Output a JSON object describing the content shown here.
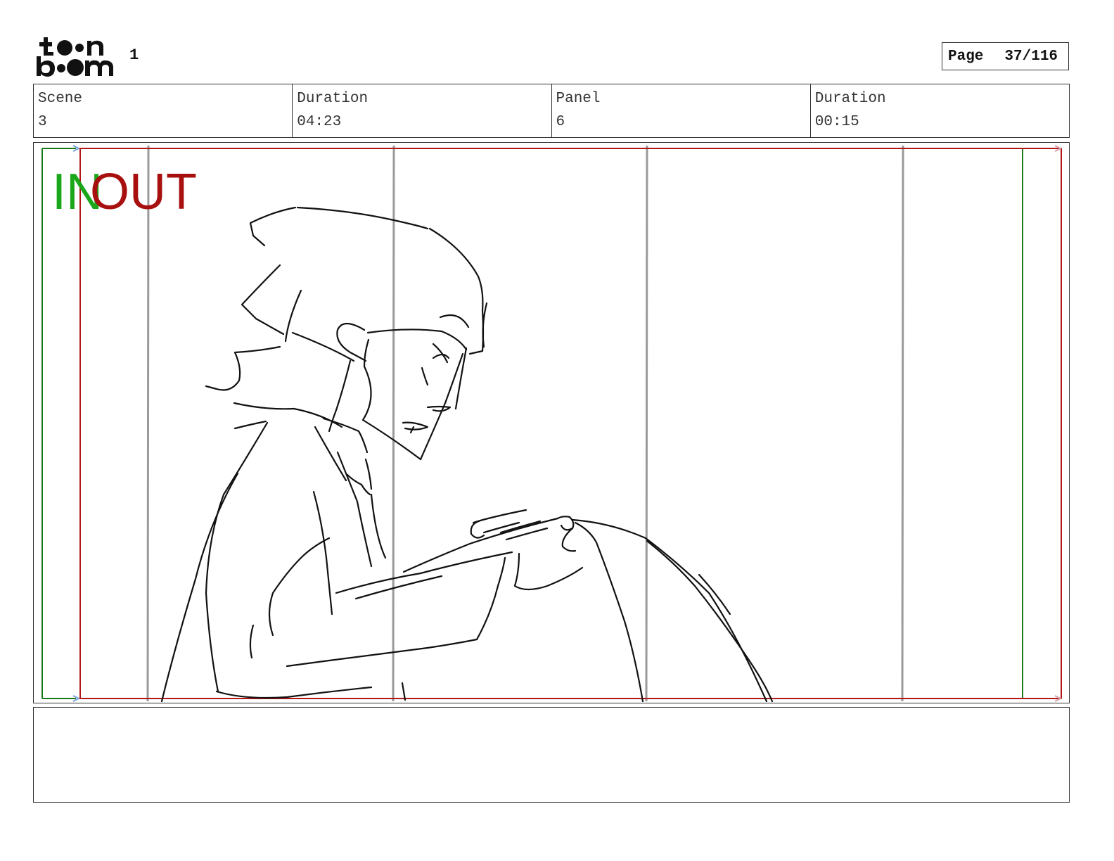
{
  "header": {
    "brand": "toon boom",
    "sequence_number": "1",
    "page_label": "Page",
    "page_value": "37/116"
  },
  "info": {
    "scene_label": "Scene",
    "scene_value": "3",
    "scene_duration_label": "Duration",
    "scene_duration_value": "04:23",
    "panel_label": "Panel",
    "panel_value": "6",
    "panel_duration_label": "Duration",
    "panel_duration_value": "00:15"
  },
  "panel": {
    "in_label": "IN",
    "out_label": "OUT",
    "colors": {
      "in": "#1aa81a",
      "out": "#a80f0f",
      "guide": "#9a9a9a",
      "sketch": "#111111"
    }
  },
  "notes": {
    "text": ""
  }
}
